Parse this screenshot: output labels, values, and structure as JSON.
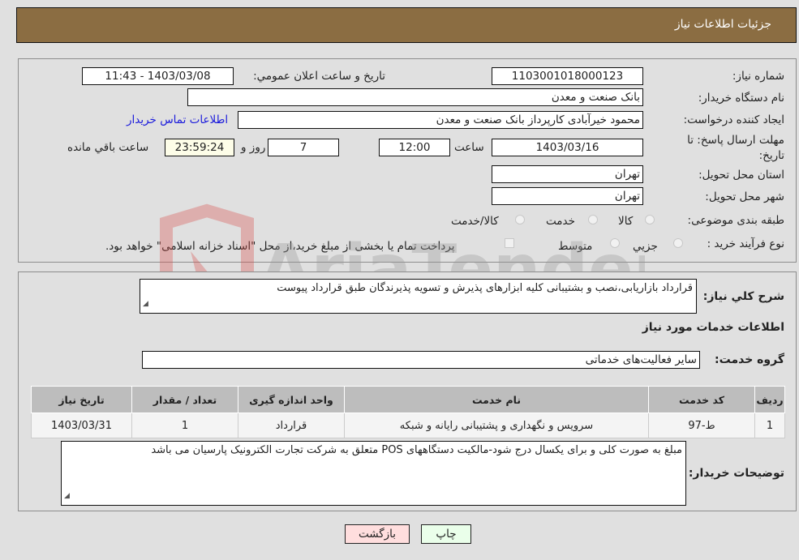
{
  "header": {
    "title": "جزئیات اطلاعات نیاز"
  },
  "fields": {
    "need_number_label": "شماره نیاز:",
    "need_number": "1103001018000123",
    "announce_label": "تاریخ و ساعت اعلان عمومي:",
    "announce_value": "1403/03/08 - 11:43",
    "buyer_org_label": "نام دستگاه خریدار:",
    "buyer_org": "بانک صنعت و معدن",
    "creator_label": "ایجاد کننده درخواست:",
    "creator": "محمود خیرآبادی کارپرداز بانک صنعت و معدن",
    "contact_link": "اطلاعات تماس خریدار",
    "deadline_label": "مهلت ارسال پاسخ: تا تاریخ:",
    "deadline_date": "1403/03/16",
    "time_label": "ساعت",
    "deadline_time": "12:00",
    "days_value": "7",
    "days_label": "روز و",
    "remaining_time": "23:59:24",
    "remaining_label": "ساعت باقي مانده",
    "province_label": "استان محل تحویل:",
    "province": "تهران",
    "city_label": "شهر محل تحویل:",
    "city": "تهران",
    "category_label": "طبقه بندی موضوعی:",
    "category_options": [
      "کالا",
      "خدمت",
      "کالا/خدمت"
    ],
    "process_label": "نوع فرآیند خرید :",
    "process_options": [
      "جزیي",
      "متوسط"
    ],
    "treasury_note": "پرداخت تمام یا بخشی از مبلغ خرید،از محل \"اسناد خزانه اسلامی\" خواهد بود."
  },
  "description": {
    "label": "شرح کلي نیاز:",
    "value": "قرارداد بازاریابی،نصب و بشتیبانی کلیه ابزارهای پذیرش و تسویه پذیرندگان طبق قرارداد پیوست"
  },
  "services": {
    "section_title": "اطلاعات خدمات مورد نیاز",
    "group_label": "گروه خدمت:",
    "group_value": "سایر فعالیت‌های خدماتی",
    "table": {
      "headers": [
        "ردیف",
        "کد خدمت",
        "نام خدمت",
        "واحد اندازه گیری",
        "تعداد / مقدار",
        "تاریخ نیاز"
      ],
      "rows": [
        [
          "1",
          "ط-97",
          "سرویس و نگهداری و پشتیبانی رایانه و شبکه",
          "قرارداد",
          "1",
          "1403/03/31"
        ]
      ]
    }
  },
  "buyer_notes": {
    "label": "توضیحات خریدار:",
    "value": "مبلغ به صورت کلی و برای یکسال درج شود-مالکیت دستگاههای POS متعلق به شرکت تجارت الکترونیک پارسیان می باشد"
  },
  "buttons": {
    "print": "چاپ",
    "back": "بازگشت"
  },
  "watermark": {
    "text": "AriaTender.neT"
  },
  "colors": {
    "header_bg": "#8b6d42",
    "print_bg": "#eaffea",
    "back_bg": "#ffdede",
    "link": "#1a1adc"
  }
}
